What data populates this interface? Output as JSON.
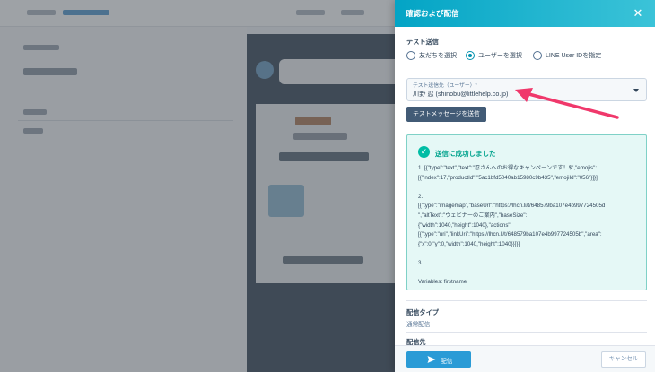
{
  "panel": {
    "title": "確認および配信",
    "close_icon": "close-icon"
  },
  "test_send": {
    "heading": "テスト送信",
    "options": [
      {
        "label": "友だちを選択",
        "selected": false
      },
      {
        "label": "ユーザーを選択",
        "selected": true
      },
      {
        "label": "LINE User IDを指定",
        "selected": false
      }
    ],
    "select_label": "テスト送信先（ユーザー）*",
    "select_value": "川野 忍 (shinobu@littlehelp.co.jp)",
    "button_label": "テストメッセージを送信"
  },
  "success": {
    "title": "送信に成功しました",
    "lines": [
      "1. [{\"type\":\"text\",\"text\":\"忍さんへのお得なキャンペーンです！$\",\"emojis\":",
      "[{\"index\":17,\"productId\":\"5ac1bfd5040ab15980c9b435\",\"emojiId\":\"056\"}]}]",
      "",
      "2.",
      "[{\"type\":\"imagemap\",\"baseUrl\":\"https://lhcn.li/t/648579ba107e4b997724505d",
      "\",\"altText\":\"ウェビナーのご案内\",\"baseSize\":",
      "{\"width\":1040,\"height\":1040},\"actions\":",
      "[{\"type\":\"uri\",\"linkUri\":\"https://lhcn.li/t/648579ba107e4b997724505b\",\"area\":",
      "{\"x\":0,\"y\":0,\"width\":1040,\"height\":1040}}]}]",
      "",
      "3.",
      "",
      "Variables: firstname"
    ]
  },
  "delivery": {
    "type_label": "配信タイプ",
    "type_value": "通常配信",
    "target_label": "配信先"
  },
  "footer": {
    "send_label": "配信",
    "cancel_label": "キャンセル"
  },
  "colors": {
    "header_start": "#03a4c5",
    "header_end": "#3bc3d8",
    "success_bg": "#e5f8f6",
    "success_accent": "#00bda5",
    "primary_button": "#2a9bd6",
    "annotation_arrow": "#f0386b"
  }
}
